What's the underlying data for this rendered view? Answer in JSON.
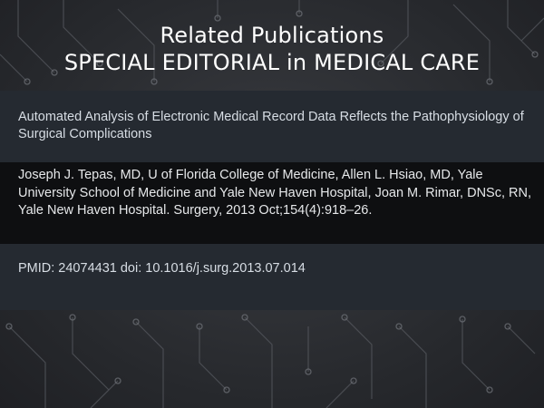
{
  "header": {
    "line1": "Related Publications",
    "line2": "SPECIAL EDITORIAL in MEDICAL CARE"
  },
  "publication": {
    "title": "Automated Analysis of Electronic Medical Record Data Reflects the Pathophysiology of Surgical Complications",
    "authors": "Joseph J. Tepas, MD, U of Florida College of Medicine, Allen L. Hsiao, MD, Yale University School of Medicine and Yale New Haven Hospital, Joan M. Rimar, DNSc, RN, Yale New Haven Hospital. Surgery, 2013 Oct;154(4):918–26.",
    "ids": "PMID: 24074431 doi: 10.1016/j.surg.2013.07.014"
  },
  "colors": {
    "panel": "#252a31",
    "authors_band": "#0e0f11",
    "text": "#d7dde4",
    "header_text": "#ffffff"
  }
}
